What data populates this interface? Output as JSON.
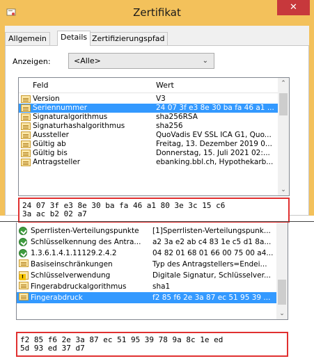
{
  "window": {
    "title": "Zertifikat",
    "close_glyph": "✕"
  },
  "tabs": [
    {
      "label": "Allgemein"
    },
    {
      "label": "Details"
    },
    {
      "label": "Zertifizierungspfad"
    }
  ],
  "details": {
    "show_label": "Anzeigen:",
    "show_value": "<Alle>",
    "columns": {
      "field": "Feld",
      "value": "Wert"
    },
    "rows": [
      {
        "field": "Version",
        "value": "V3"
      },
      {
        "field": "Seriennummer",
        "value": "24 07 3f e3 8e 30 ba fa 46 a1 ..."
      },
      {
        "field": "Signaturalgorithmus",
        "value": "sha256RSA"
      },
      {
        "field": "Signaturhashalgorithmus",
        "value": "sha256"
      },
      {
        "field": "Aussteller",
        "value": "QuoVadis EV SSL ICA G1, Quo..."
      },
      {
        "field": "Gültig ab",
        "value": "Freitag, 13. Dezember 2019 0..."
      },
      {
        "field": "Gültig bis",
        "value": "Donnerstag, 15. Juli 2021 02:..."
      },
      {
        "field": "Antragsteller",
        "value": "ebanking.bbl.ch, Hypothekarb..."
      }
    ],
    "selected_value_line1": "24 07 3f e3 8e 30 ba fa 46 a1 80 3e 3c 15 c6",
    "selected_value_line2": "3a ac b2 02 a7"
  },
  "details2": {
    "rows": [
      {
        "field": "Sperrlisten-Verteilungspunkte",
        "value": "[1]Sperrlisten-Verteilungspunk..."
      },
      {
        "field": "Schlüsselkennung des Antra...",
        "value": "a2 3a e2 ab c4 83 1e c5 d1 8a..."
      },
      {
        "field": "1.3.6.1.4.1.11129.2.4.2",
        "value": "04 82 01 68 01 66 00 75 00 a4..."
      },
      {
        "field": "Basiseinschränkungen",
        "value": "Typ des Antragstellers=Endei..."
      },
      {
        "field": "Schlüsselverwendung",
        "value": "Digitale Signatur, Schlüsselver..."
      },
      {
        "field": "Fingerabdruckalgorithmus",
        "value": "sha1"
      },
      {
        "field": "Fingerabdruck",
        "value": "f2 85 f6 2e 3a 87 ec 51 95 39 ..."
      }
    ],
    "selected_value_line1": "f2 85 f6 2e 3a 87 ec 51 95 39 78 9a 8c 1e ed",
    "selected_value_line2": "5d 93 ed 37 d7"
  },
  "colors": {
    "titlebar": "#f3c15b",
    "selection": "#3399ff",
    "close": "#c7383c",
    "highlight_border": "#e03030"
  }
}
